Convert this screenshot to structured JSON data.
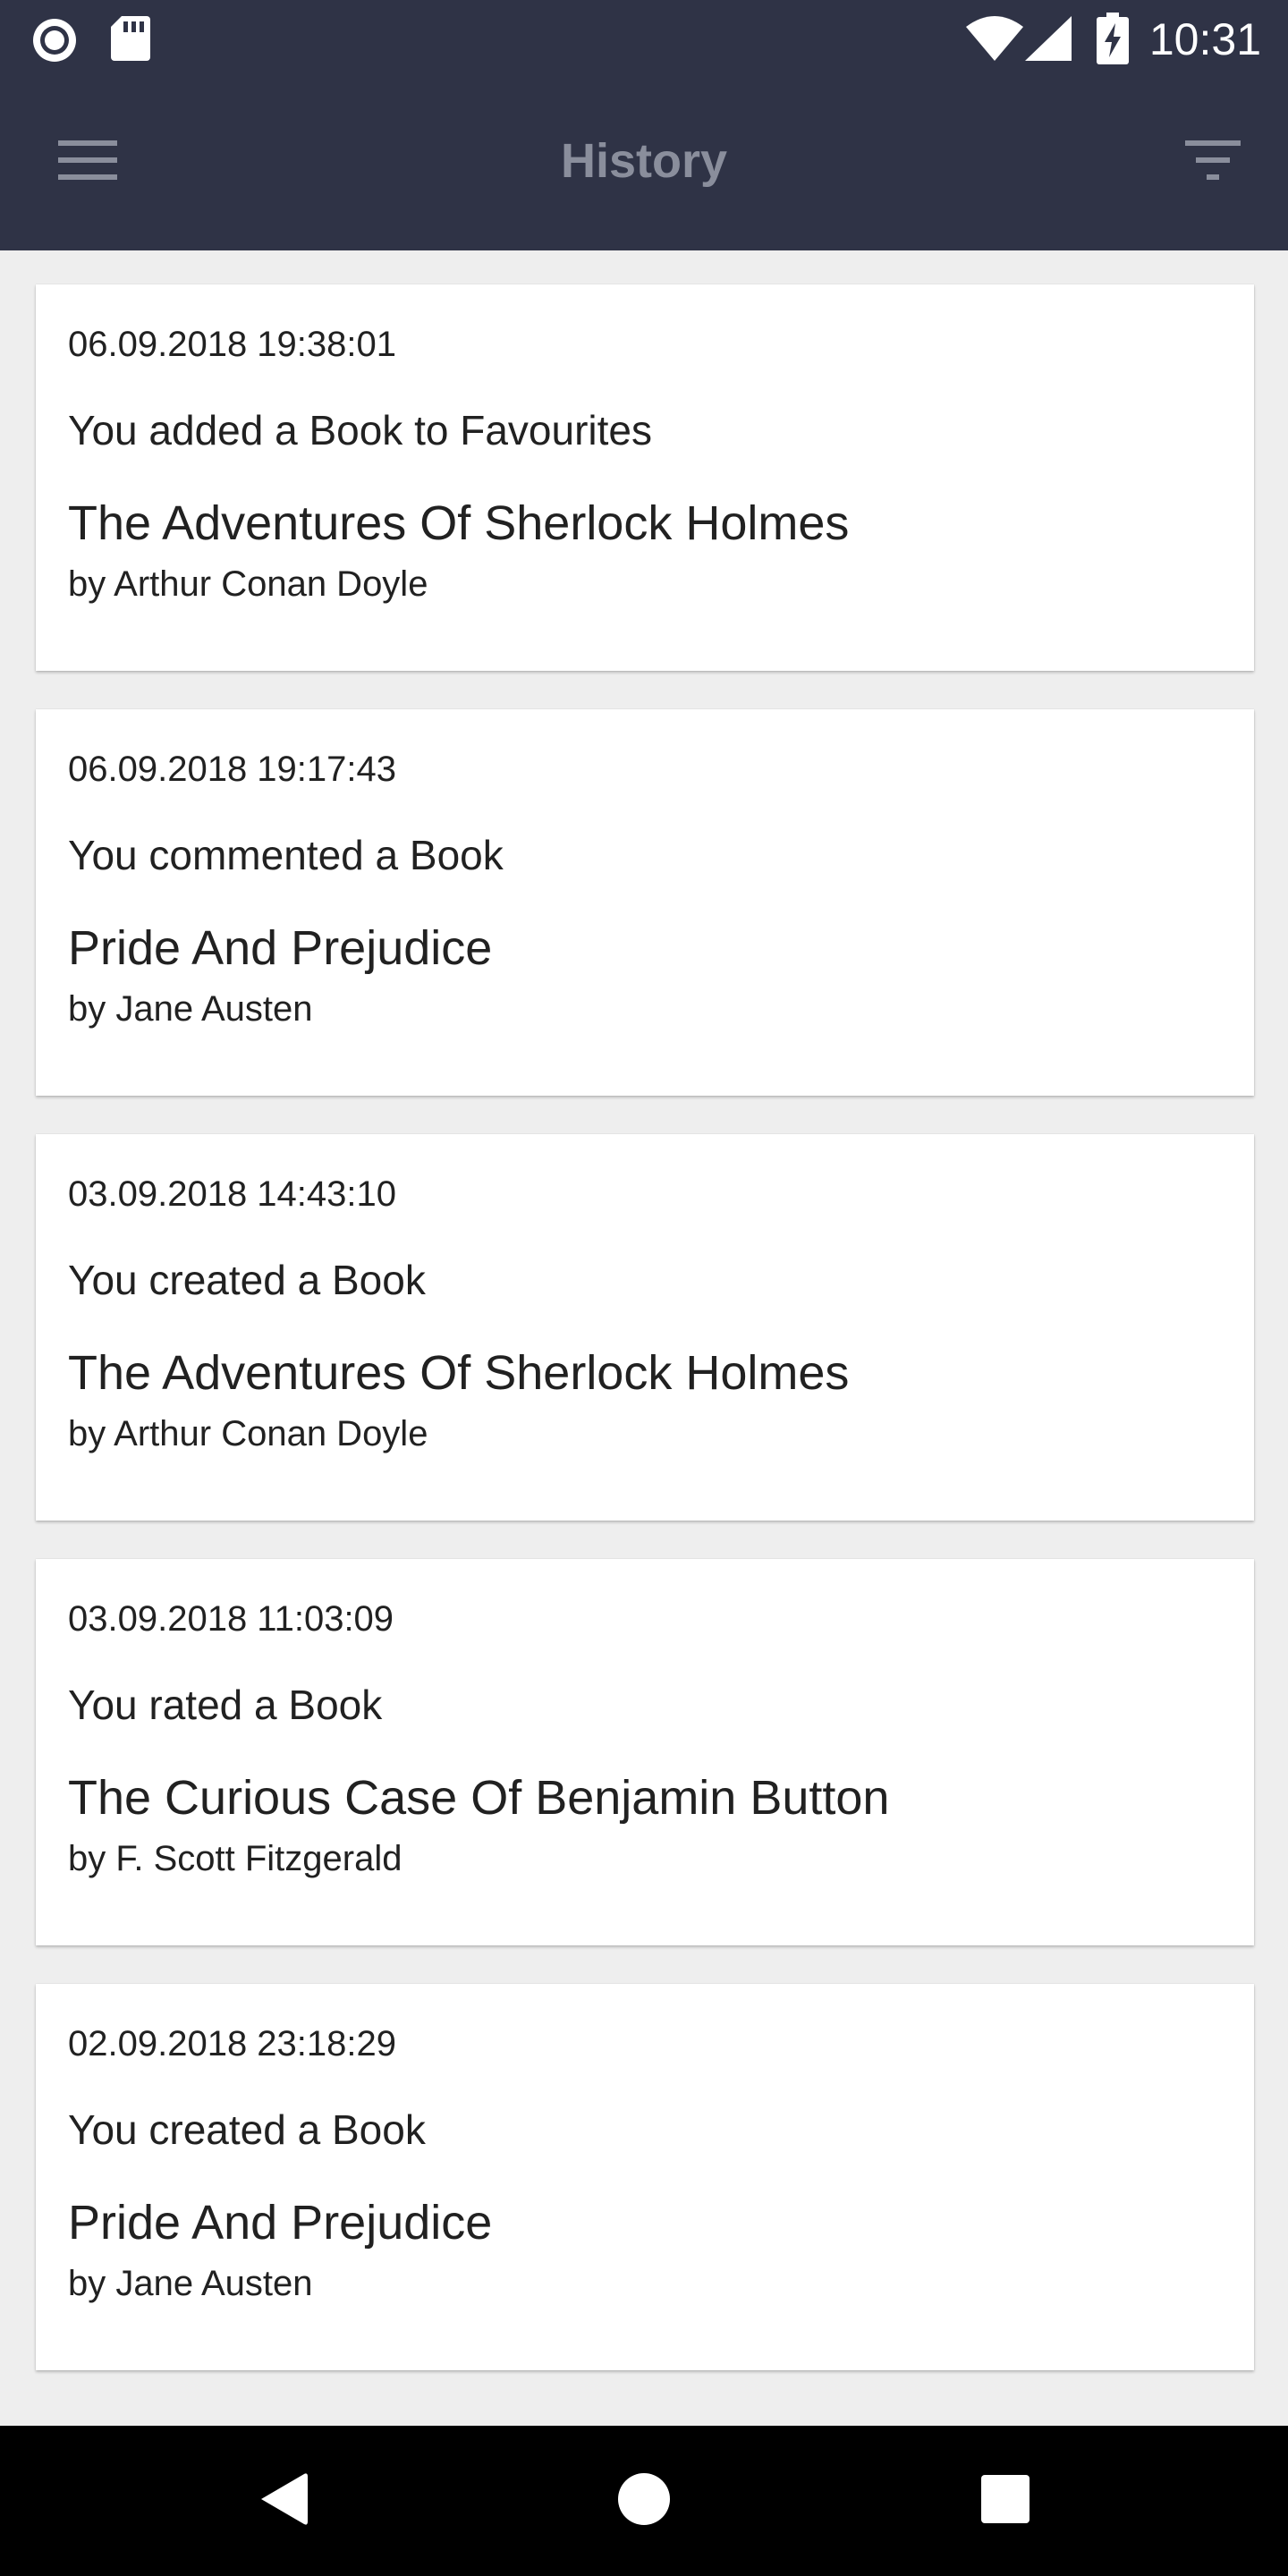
{
  "status_bar": {
    "time": "10:31",
    "icons": [
      "recording-circle-icon",
      "sd-card-icon",
      "wifi-icon",
      "cell-signal-icon",
      "battery-charging-icon"
    ]
  },
  "app_bar": {
    "title": "History",
    "menu_icon": "hamburger-menu-icon",
    "filter_icon": "filter-icon",
    "background": "#2f3346",
    "title_color": "#8a8e9c"
  },
  "history": [
    {
      "timestamp": "06.09.2018 19:38:01",
      "action": "You added a Book to Favourites",
      "book_title": "The Adventures Of Sherlock Holmes",
      "author": "by Arthur Conan Doyle"
    },
    {
      "timestamp": "06.09.2018 19:17:43",
      "action": "You commented a Book",
      "book_title": "Pride And Prejudice",
      "author": "by Jane Austen"
    },
    {
      "timestamp": "03.09.2018 14:43:10",
      "action": "You created a Book",
      "book_title": "The Adventures Of Sherlock Holmes",
      "author": "by Arthur Conan Doyle"
    },
    {
      "timestamp": "03.09.2018 11:03:09",
      "action": "You rated a Book",
      "book_title": "The Curious Case Of Benjamin Button",
      "author": "by F. Scott Fitzgerald"
    },
    {
      "timestamp": "02.09.2018 23:18:29",
      "action": "You created a Book",
      "book_title": "Pride And Prejudice",
      "author": "by Jane Austen"
    }
  ],
  "nav_bar": {
    "icons": [
      "back-triangle-icon",
      "home-circle-icon",
      "recents-square-icon"
    ]
  }
}
